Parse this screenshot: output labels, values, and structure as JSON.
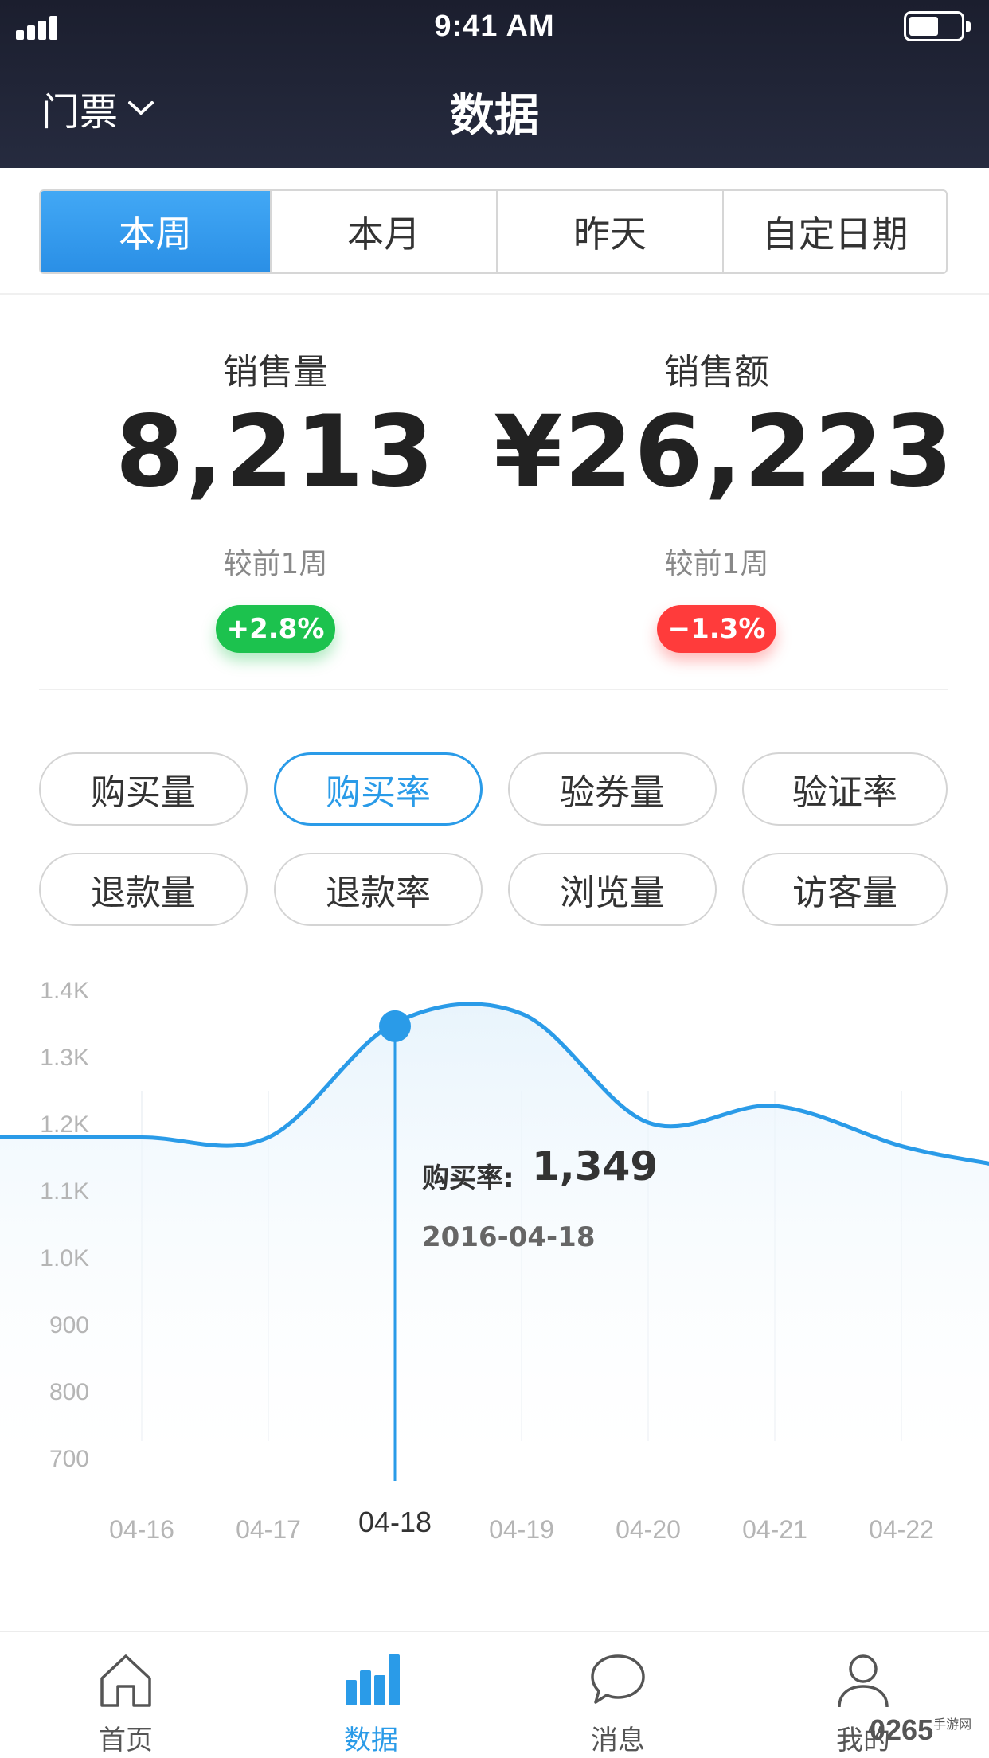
{
  "status_bar": {
    "time": "9:41 AM"
  },
  "header": {
    "selector_label": "门票",
    "title": "数据"
  },
  "period_tabs": [
    "本周",
    "本月",
    "昨天",
    "自定日期"
  ],
  "summary": {
    "sales_volume": {
      "label": "销售量",
      "value": "8,213",
      "compare": "较前1周",
      "change": "+2.8%"
    },
    "sales_amount": {
      "label": "销售额",
      "value": "¥26,223",
      "compare": "较前1周",
      "change": "−1.3%"
    }
  },
  "metric_chips": [
    "购买量",
    "购买率",
    "验券量",
    "验证率",
    "退款量",
    "退款率",
    "浏览量",
    "访客量"
  ],
  "tooltip": {
    "label": "购买率:",
    "value": "1,349",
    "date": "2016-04-18"
  },
  "chart_data": {
    "type": "area",
    "series": [
      {
        "name": "购买率",
        "values": [
          1178,
          1178,
          1349,
          1363,
          1200,
          1225,
          1165
        ]
      }
    ],
    "x": [
      "04-16",
      "04-17",
      "04-18",
      "04-19",
      "04-20",
      "04-21",
      "04-22"
    ],
    "y_ticks": [
      "1.4K",
      "1.3K",
      "1.2K",
      "1.1K",
      "1.0K",
      "900",
      "800",
      "700"
    ],
    "ylim": [
      700,
      1400
    ],
    "highlight": {
      "x": "04-18",
      "value": 1349
    },
    "colors": {
      "line": "#2a9be8",
      "fill": "#eaf5fd"
    }
  },
  "tabbar": {
    "items": [
      {
        "label": "首页",
        "icon": "home-icon"
      },
      {
        "label": "数据",
        "icon": "bar-chart-icon"
      },
      {
        "label": "消息",
        "icon": "message-icon"
      },
      {
        "label": "我的",
        "icon": "user-icon"
      }
    ]
  },
  "watermark": {
    "text": "0265",
    "sub": "手游网"
  }
}
